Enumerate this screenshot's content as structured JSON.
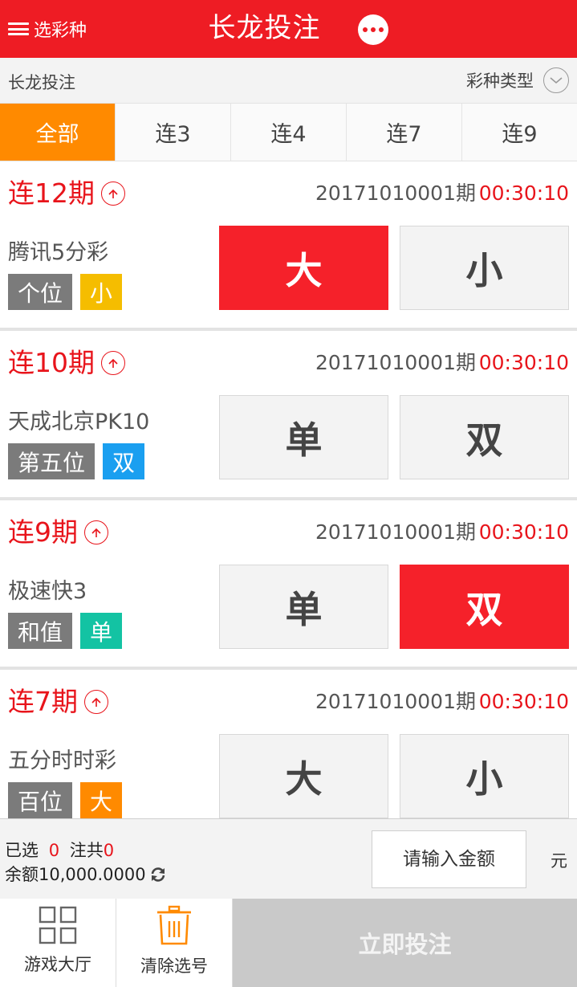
{
  "header": {
    "menu_label": "选彩种",
    "title": "长龙投注"
  },
  "subbar": {
    "title": "长龙投注",
    "type_label": "彩种类型"
  },
  "tabs": [
    {
      "label": "全部",
      "active": true
    },
    {
      "label": "连3",
      "active": false
    },
    {
      "label": "连4",
      "active": false
    },
    {
      "label": "连7",
      "active": false
    },
    {
      "label": "连9",
      "active": false
    }
  ],
  "cards": [
    {
      "streak": "连12期",
      "issue": "20171010001期",
      "timer": "00:30:10",
      "game": "腾讯5分彩",
      "position": "个位",
      "result": "小",
      "result_color": "#f5bd00",
      "options": [
        "大",
        "小"
      ],
      "selected": 0
    },
    {
      "streak": "连10期",
      "issue": "20171010001期",
      "timer": "00:30:10",
      "game": "天成北京PK10",
      "position": "第五位",
      "result": "双",
      "result_color": "#1a9ff0",
      "options": [
        "单",
        "双"
      ],
      "selected": -1
    },
    {
      "streak": "连9期",
      "issue": "20171010001期",
      "timer": "00:30:10",
      "game": "极速快3",
      "position": "和值",
      "result": "单",
      "result_color": "#13c3a3",
      "options": [
        "单",
        "双"
      ],
      "selected": 1
    },
    {
      "streak": "连7期",
      "issue": "20171010001期",
      "timer": "00:30:10",
      "game": "五分时时彩",
      "position": "百位",
      "result": "大",
      "result_color": "#ff8a00",
      "options": [
        "大",
        "小"
      ],
      "selected": -1
    }
  ],
  "summary": {
    "selected_prefix": "已选",
    "selected_count": "0",
    "bets_label": "注共",
    "bets_count": "0",
    "balance_label": "余额",
    "balance_value": "10,000.0000",
    "amount_placeholder": "请输入金额",
    "unit": "元"
  },
  "toolbar": {
    "lobby_label": "游戏大厅",
    "clear_label": "清除选号",
    "submit_label": "立即投注"
  },
  "colors": {
    "brand_red": "#ee1c24",
    "tab_active": "#ff8a00",
    "selected_bet": "#f5212a",
    "icon_orange": "#ff8a00"
  }
}
